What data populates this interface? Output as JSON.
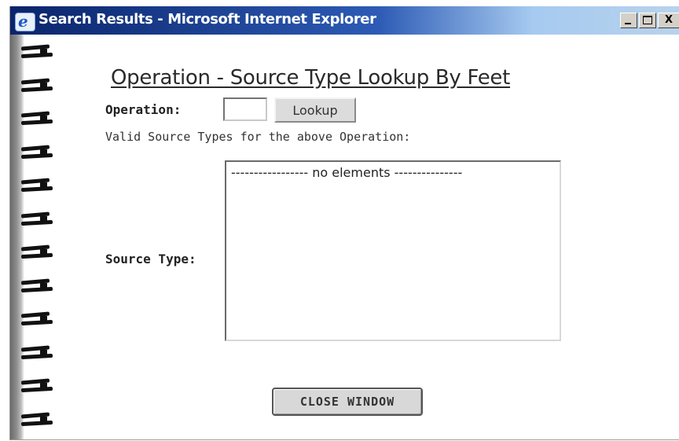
{
  "window": {
    "title": "Search Results - Microsoft Internet Explorer",
    "icon": "ie-icon",
    "controls": {
      "minimize": "minimize-icon",
      "maximize": "maximize-icon",
      "close_label": "X"
    }
  },
  "page": {
    "heading": "Operation - Source Type Lookup By Feet",
    "operation_label": "Operation:",
    "operation_value": "",
    "lookup_label": "Lookup",
    "valid_text": "Valid Source Types for the above Operation:",
    "source_type_label": "Source Type:",
    "source_type_options": [
      "----------------- no elements ---------------"
    ],
    "close_label": "CLOSE WINDOW"
  },
  "colors": {
    "titlebar_start": "#0a246a",
    "titlebar_end": "#b8d2ec",
    "spiral_binding": "#111111"
  }
}
